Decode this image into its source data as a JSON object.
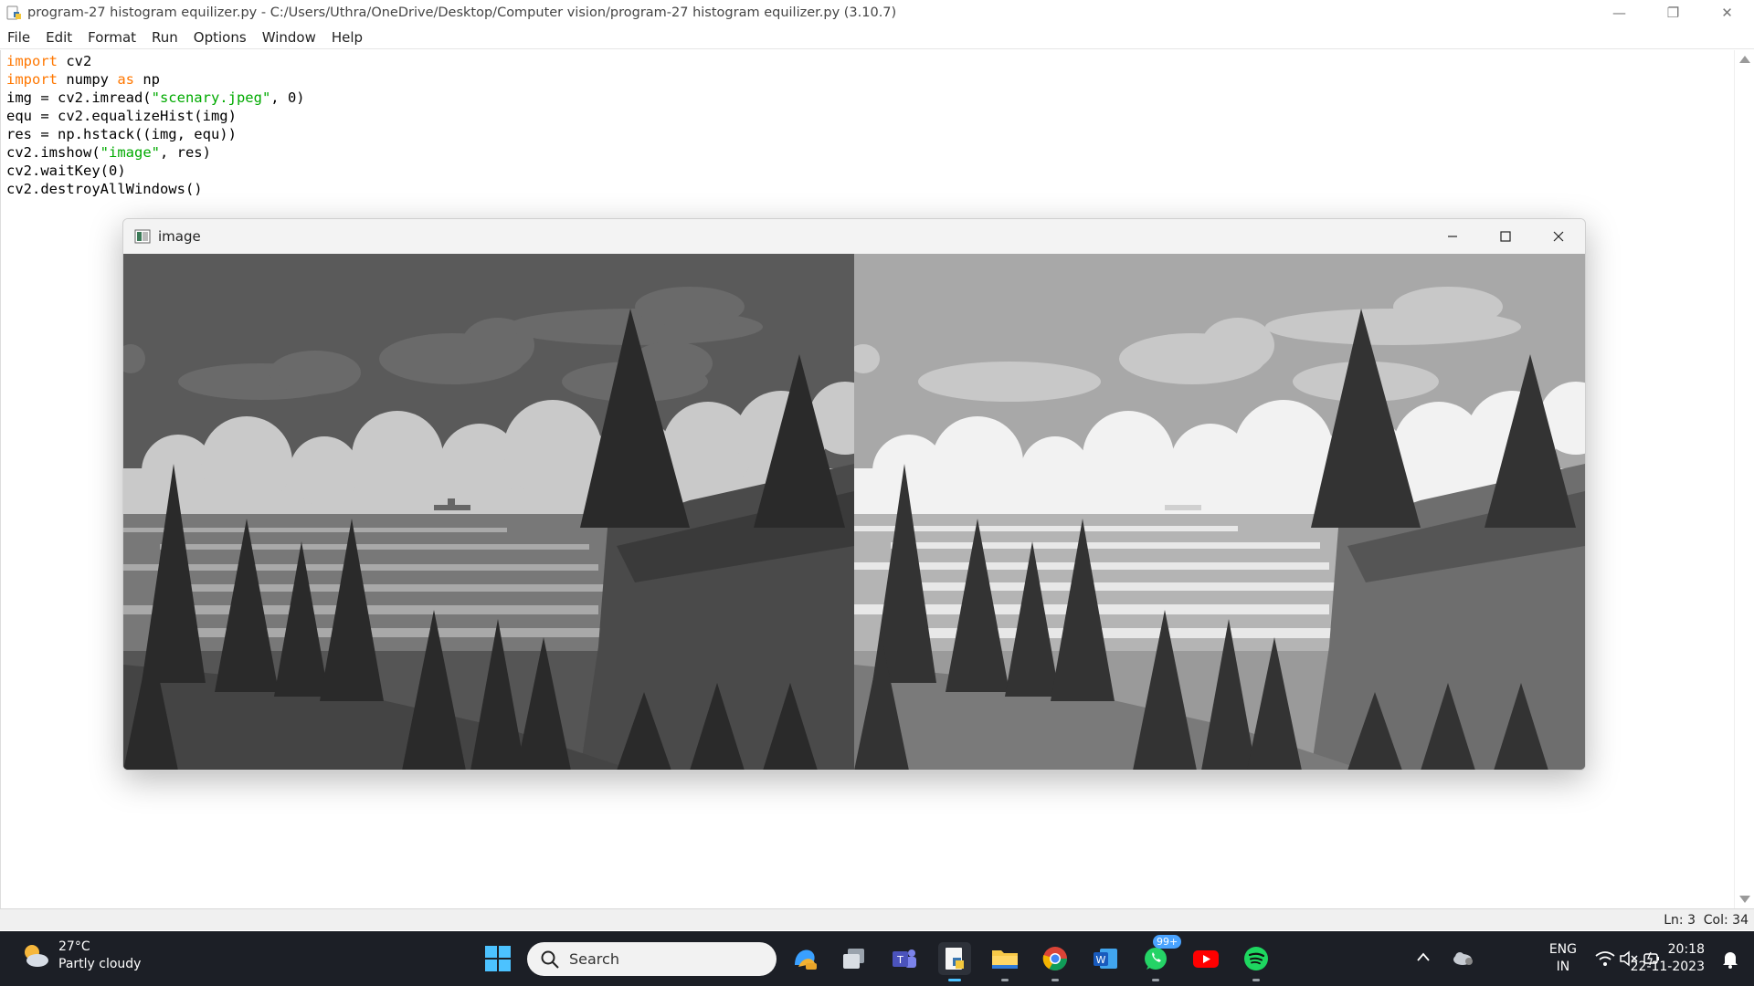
{
  "window": {
    "title": "program-27 histogram equilizer.py - C:/Users/Uthra/OneDrive/Desktop/Computer vision/program-27 histogram equilizer.py (3.10.7)",
    "controls": {
      "minimize": "—",
      "restore": "❐",
      "close": "✕"
    }
  },
  "menu": {
    "items": [
      "File",
      "Edit",
      "Format",
      "Run",
      "Options",
      "Window",
      "Help"
    ]
  },
  "code": {
    "lines": [
      [
        {
          "t": "import",
          "k": "kw"
        },
        {
          "t": " cv2"
        }
      ],
      [
        {
          "t": "import",
          "k": "kw"
        },
        {
          "t": " numpy "
        },
        {
          "t": "as",
          "k": "kw"
        },
        {
          "t": " np"
        }
      ],
      [
        {
          "t": "img = cv2.imread("
        },
        {
          "t": "\"scenary.jpeg\"",
          "k": "str"
        },
        {
          "t": ", 0)"
        }
      ],
      [
        {
          "t": "equ = cv2.equalizeHist(img)"
        }
      ],
      [
        {
          "t": "res = np.hstack((img, equ))"
        }
      ],
      [
        {
          "t": "cv2.imshow("
        },
        {
          "t": "\"image\"",
          "k": "str"
        },
        {
          "t": ", res)"
        }
      ],
      [
        {
          "t": "cv2.waitKey(0)"
        }
      ],
      [
        {
          "t": "cv2.destroyAllWindows()"
        }
      ]
    ]
  },
  "status": {
    "line": "Ln: 3",
    "col": "Col: 34"
  },
  "image_window": {
    "title": "image"
  },
  "taskbar": {
    "weather": {
      "temp": "27°C",
      "desc": "Partly cloudy"
    },
    "search_placeholder": "Search",
    "whatsapp_badge": "99+",
    "lang": {
      "line1": "ENG",
      "line2": "IN"
    },
    "clock": {
      "time": "20:18",
      "date": "22-11-2023"
    }
  },
  "colors": {
    "keyword": "#ff7700",
    "string": "#00aa00",
    "taskbar_bg": "#1c1f26"
  }
}
